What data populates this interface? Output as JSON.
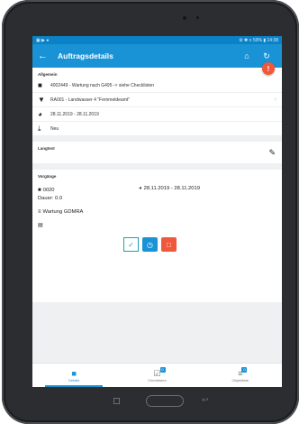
{
  "statusbar": {
    "left": "▣ ▶ ●",
    "right": "⚙ ✱ ≡ 59% ▮ 14:38"
  },
  "appbar": {
    "back_icon": "←",
    "title": "Auftragsdetails",
    "home_icon": "⌂",
    "sync_icon": "↻",
    "alert": "!"
  },
  "allgemein": {
    "title": "Allgemein",
    "rows": [
      {
        "icon": "briefcase-icon",
        "glyph": "■",
        "text": "4002449 - Wartung nach G495 -> siehe Checklisten"
      },
      {
        "icon": "location-pin-icon",
        "glyph": "▼",
        "text": "RA001 - Landwasser 4 \"Fernmeldeamt\"",
        "chevron": "›"
      },
      {
        "icon": "clock-icon",
        "glyph": "◕",
        "text": "28.11.2019 - 28.11.2019"
      },
      {
        "icon": "download-icon",
        "glyph": "⤓",
        "text": "Neu"
      }
    ]
  },
  "langtext": {
    "title": "Langtext",
    "edit_icon": "✎"
  },
  "vorgaenge": {
    "title": "Vorgänge",
    "number": "0020",
    "time": "28.11.2019 - 28.11.2019",
    "duration": "Dauer: 0.0",
    "description": "Wartung GDMRA",
    "doc_glyph": "▤",
    "check_glyph": "✓",
    "time_glyph": "◷",
    "delete_glyph": "□"
  },
  "bottomnav": [
    {
      "label": "Details",
      "glyph": "■",
      "badge": "",
      "active": true
    },
    {
      "label": "Checklisten",
      "glyph": "☑",
      "badge": "0",
      "active": false
    },
    {
      "label": "Objektliste",
      "glyph": "≡",
      "badge": "0",
      "active": false
    }
  ],
  "colors": {
    "primary": "#1a93d6",
    "accent": "#f0583c",
    "teal": "#19a3b8"
  }
}
